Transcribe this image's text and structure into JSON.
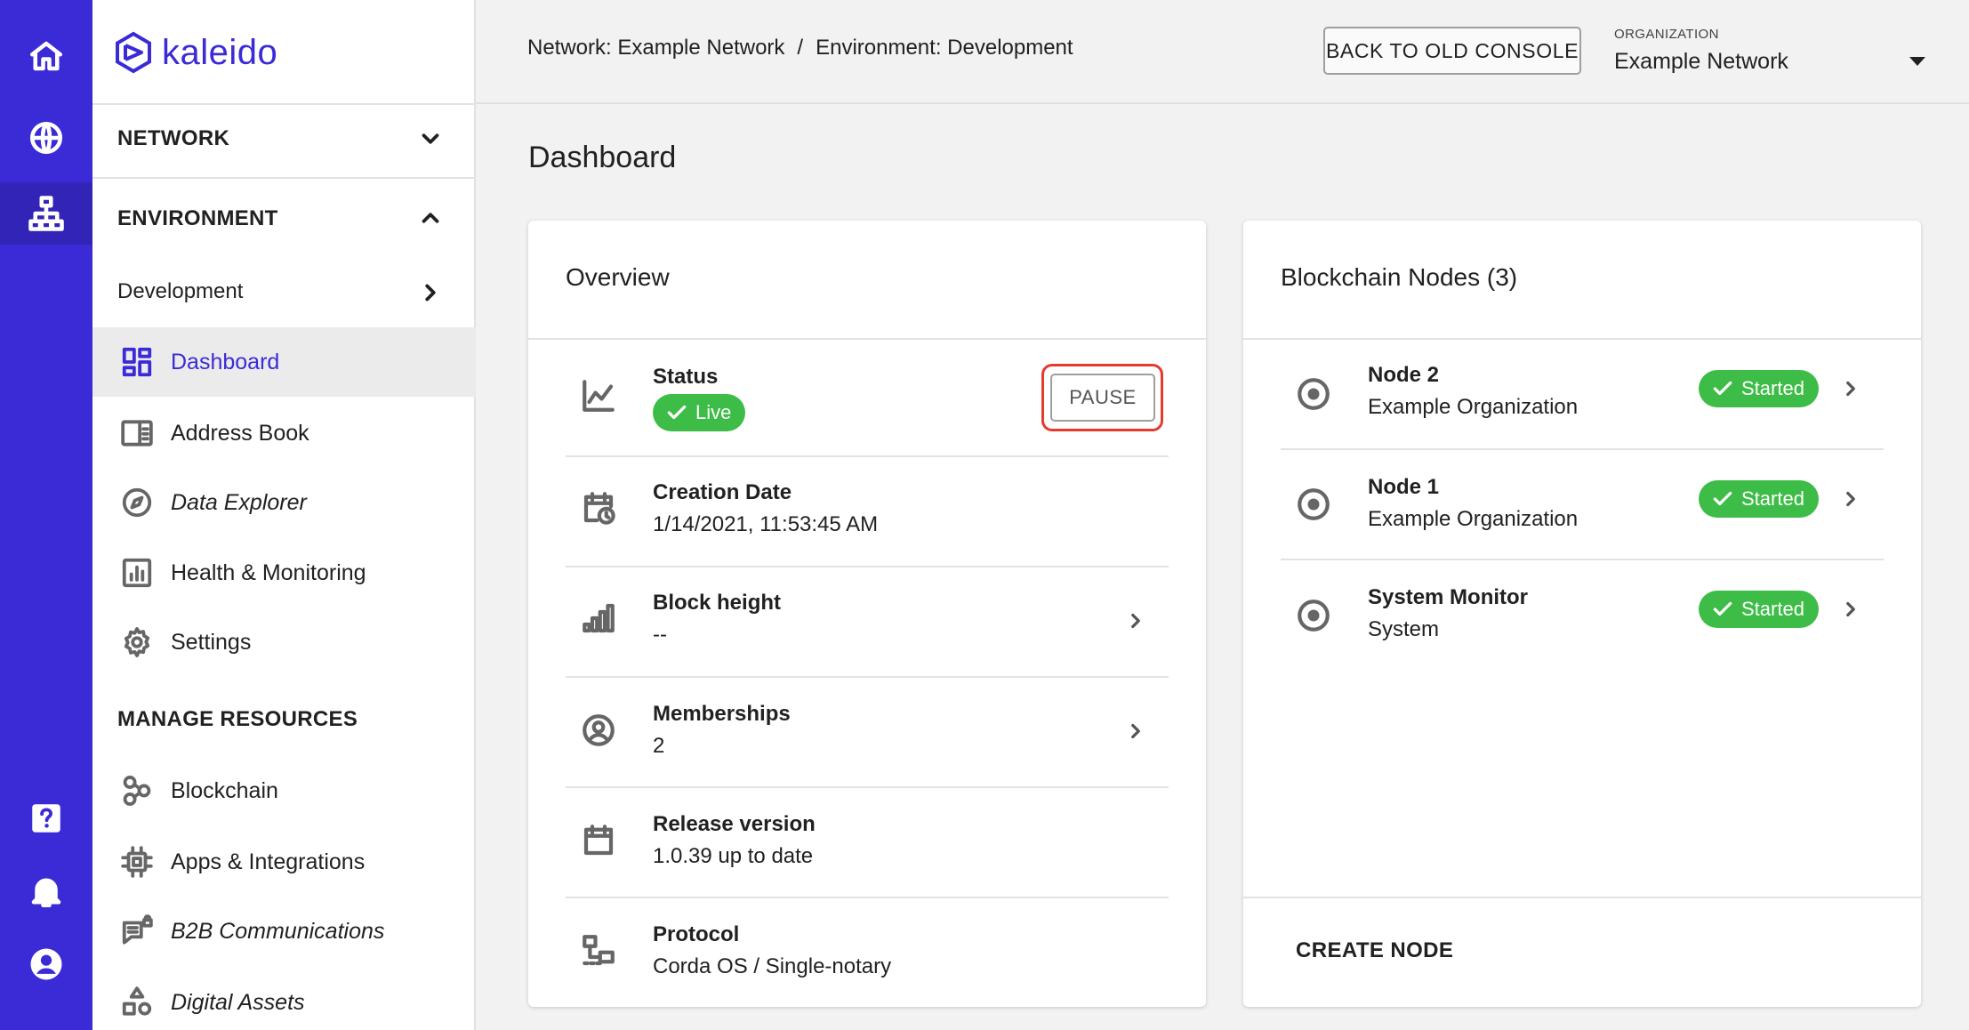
{
  "app": {
    "name": "kaleido"
  },
  "rail": {
    "icons": [
      "home-icon",
      "globe-icon",
      "network-topology-icon",
      "help-icon",
      "bell-icon",
      "account-icon"
    ]
  },
  "sidebar": {
    "network_label": "NETWORK",
    "environment_label": "ENVIRONMENT",
    "environment_name": "Development",
    "items": [
      {
        "label": "Dashboard",
        "icon": "dashboard-icon",
        "active": true
      },
      {
        "label": "Address Book",
        "icon": "address-book-icon"
      },
      {
        "label": "Data Explorer",
        "icon": "compass-icon"
      },
      {
        "label": "Health & Monitoring",
        "icon": "bar-chart-icon"
      },
      {
        "label": "Settings",
        "icon": "gear-icon"
      }
    ],
    "manage_label": "MANAGE RESOURCES",
    "resources": [
      {
        "label": "Blockchain",
        "icon": "blockchain-icon"
      },
      {
        "label": "Apps & Integrations",
        "icon": "chip-icon"
      },
      {
        "label": "B2B Communications",
        "icon": "chat-lock-icon"
      },
      {
        "label": "Digital Assets",
        "icon": "shapes-icon"
      }
    ]
  },
  "header": {
    "breadcrumb_network": "Network: Example Network",
    "breadcrumb_sep": "/",
    "breadcrumb_env": "Environment: Development",
    "back_button": "BACK TO OLD CONSOLE",
    "org_label": "ORGANIZATION",
    "org_value": "Example Network"
  },
  "page": {
    "title": "Dashboard"
  },
  "overview": {
    "title": "Overview",
    "status": {
      "title": "Status",
      "badge": "Live",
      "pause_button": "PAUSE"
    },
    "creation": {
      "title": "Creation Date",
      "value": "1/14/2021, 11:53:45 AM"
    },
    "block_height": {
      "title": "Block height",
      "value": "--"
    },
    "memberships": {
      "title": "Memberships",
      "value": "2"
    },
    "release": {
      "title": "Release version",
      "value": "1.0.39 up to date"
    },
    "protocol": {
      "title": "Protocol",
      "value": "Corda OS / Single-notary"
    }
  },
  "nodes": {
    "title": "Blockchain Nodes (3)",
    "items": [
      {
        "name": "Node 2",
        "org": "Example Organization",
        "status": "Started"
      },
      {
        "name": "Node 1",
        "org": "Example Organization",
        "status": "Started"
      },
      {
        "name": "System Monitor",
        "org": "System",
        "status": "Started"
      }
    ],
    "create_button": "CREATE NODE"
  },
  "colors": {
    "brand": "#3b2bd6",
    "success": "#3dbd47",
    "highlight": "#e53b2c"
  }
}
